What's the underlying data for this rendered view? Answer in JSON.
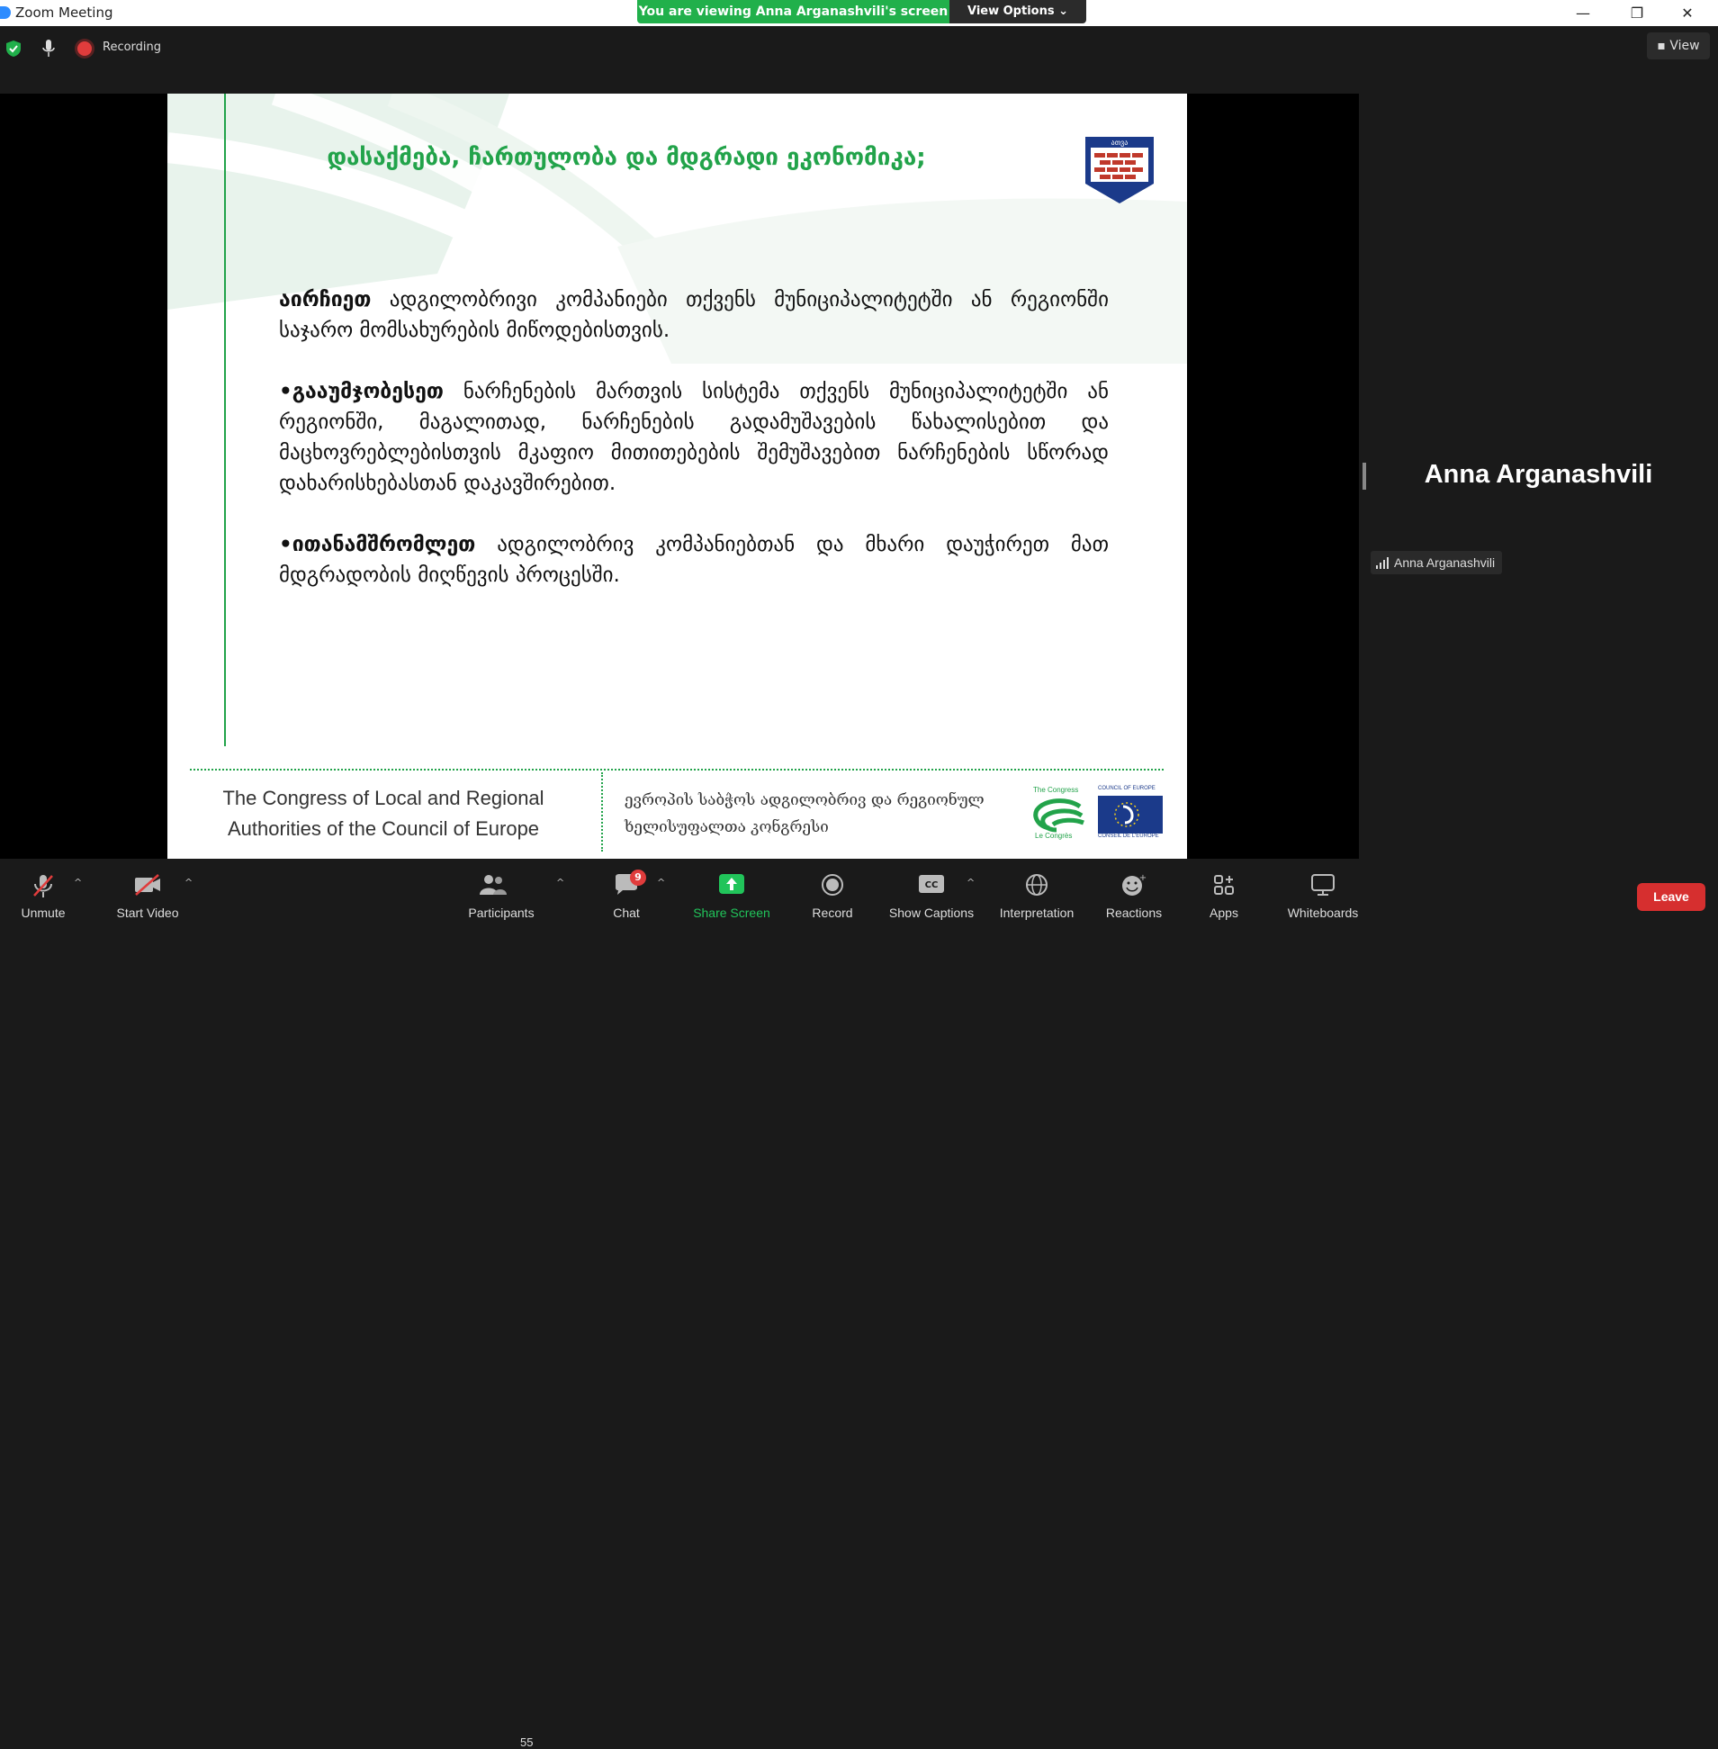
{
  "window": {
    "title": "Zoom Meeting",
    "viewing_banner": "You are viewing Anna Arganashvili's screen",
    "view_options": "View Options",
    "minimize": "—",
    "restore": "❐",
    "close": "✕"
  },
  "header": {
    "recording_label": "Recording",
    "view_label": "View"
  },
  "slide": {
    "title": "დასაქმება, ჩართულობა და მდგრადი ეკონომიკა;",
    "paragraphs": [
      {
        "bold": "აირჩიეთ",
        "text": " ადგილობრივი კომპანიები თქვენს მუნიციპალიტეტში ან რეგიონში საჯარო მომსახურების მიწოდებისთვის."
      },
      {
        "bold": "•გააუმჯობესეთ",
        "text": " ნარჩენების მართვის სისტემა თქვენს მუნიციპალიტეტში ან რეგიონში, მაგალითად, ნარჩენების გადამუშავების წახალისებით და მაცხოვრებლებისთვის მკაფიო მითითებების შემუშავებით ნარჩენების სწორად დახარისხებასთან დაკავშირებით."
      },
      {
        "bold": "•ითანამშრომლეთ",
        "text": " ადგილობრივ კომპანიებთან და მხარი დაუჭირეთ მათ მდგრადობის მიღწევის პროცესში."
      }
    ],
    "footer_left_line1": "The Congress of Local and Regional",
    "footer_left_line2": "Authorities of the Council of Europe",
    "footer_mid_line1": "ევროპის საბჭოს ადგილობრივ და რეგიონულ",
    "footer_mid_line2": "ხელისუფალთა კონგრესი",
    "congress_top": "The Congress",
    "congress_bottom": "Le Congrès",
    "coe_top": "COUNCIL OF EUROPE",
    "coe_bottom": "CONSEIL DE L'EUROPE",
    "logo_text": "ათვა"
  },
  "speaker": {
    "name": "Anna Arganashvili",
    "tag_name": "Anna Arganashvili"
  },
  "toolbar": {
    "unmute": "Unmute",
    "start_video": "Start Video",
    "participants": "Participants",
    "participants_count": "55",
    "chat": "Chat",
    "chat_badge": "9",
    "share_screen": "Share Screen",
    "record": "Record",
    "show_captions": "Show Captions",
    "interpretation": "Interpretation",
    "reactions": "Reactions",
    "apps": "Apps",
    "whiteboards": "Whiteboards",
    "leave": "Leave"
  },
  "colors": {
    "banner_green": "#21b04b",
    "slide_green": "#22a34a",
    "leave_red": "#d62f2f",
    "share_green": "#21c45a"
  }
}
